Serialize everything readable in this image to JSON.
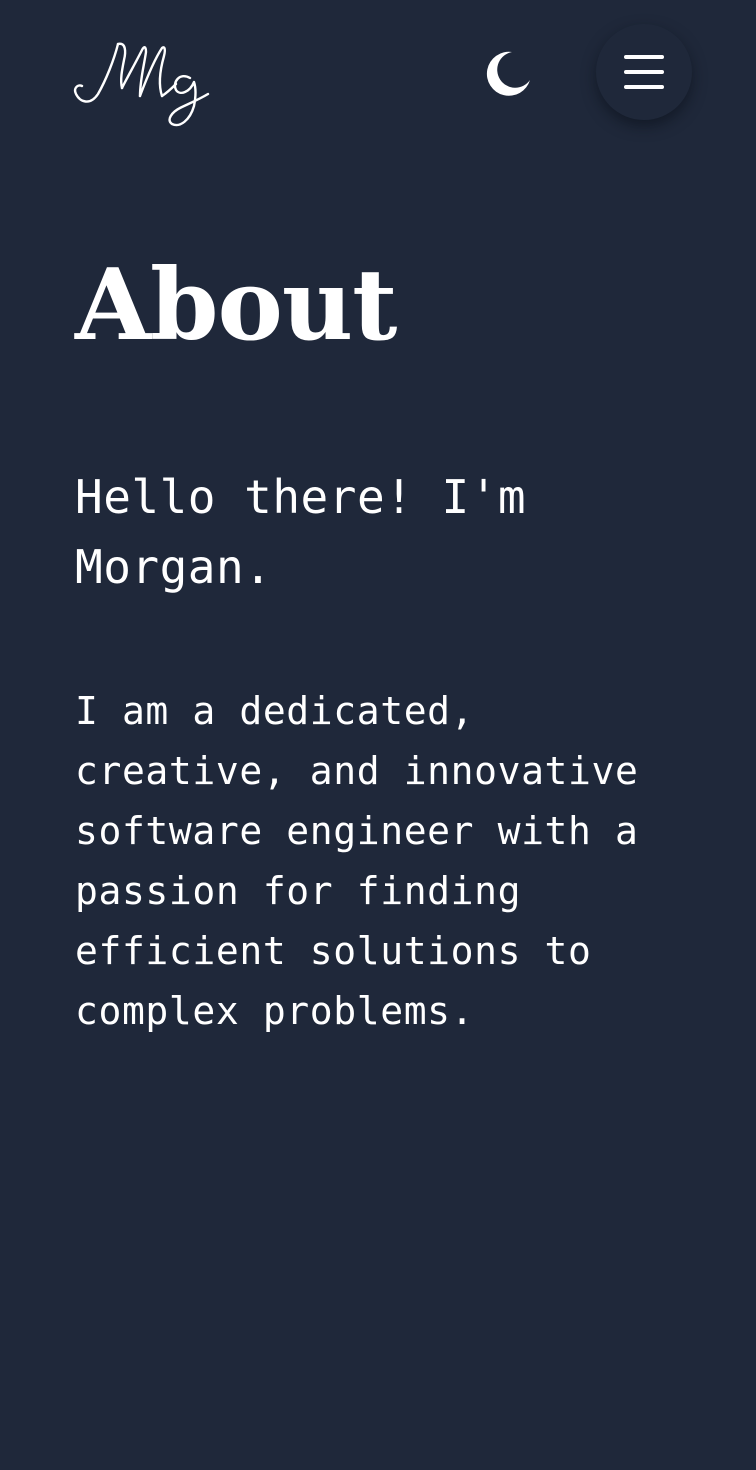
{
  "header": {
    "logo_text": "Mg",
    "theme_toggle_icon": "moon-icon",
    "menu_icon": "hamburger-menu-icon"
  },
  "main": {
    "title": "About",
    "greeting": "Hello there! I'm Morgan.",
    "bio": "I am a dedicated, creative, and innovative software engineer with a passion for finding efficient solutions to complex problems."
  },
  "colors": {
    "background": "#1f283a",
    "text": "#ffffff"
  }
}
